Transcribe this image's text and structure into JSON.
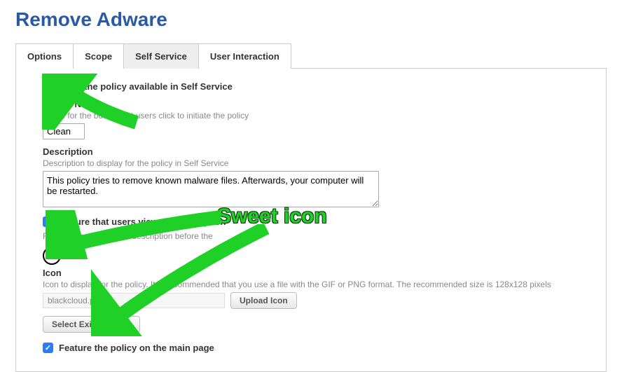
{
  "title": "Remove Adware",
  "tabs": {
    "options": "Options",
    "scope": "Scope",
    "self_service": "Self Service",
    "user_interaction": "User Interaction"
  },
  "make_available": {
    "label": "Make the policy available in Self Service"
  },
  "button_name": {
    "title": "Button N",
    "help": "Name for the button that users click to initiate the policy",
    "value": "Clean"
  },
  "description": {
    "title": "Description",
    "help": "Description to display for the policy in Self Service",
    "value": "This policy tries to remove known malware files. Afterwards, your computer will be restarted."
  },
  "ensure_view": {
    "label": "Ensure that users view the description",
    "help": "Force users to view the description before the"
  },
  "icon": {
    "title": "Icon",
    "help": "Icon to display for the policy. It is recommended that you use a file with the GIF or PNG format. The recommended size is 128x128 pixels",
    "filename": "blackcloud.png",
    "upload_label": "Upload Icon",
    "select_label": "Select Existing Icon"
  },
  "feature": {
    "label": "Feature the policy on the main page"
  },
  "annotation": {
    "sweet_icon": "Sweet icon"
  }
}
